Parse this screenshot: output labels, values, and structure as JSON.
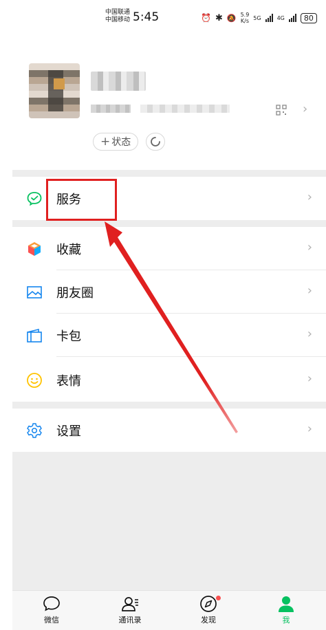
{
  "status_bar": {
    "carrier_1": "中国联通",
    "carrier_2": "中国移动",
    "time": "5:45",
    "net_speed_value": "5.9",
    "net_speed_unit": "K/s",
    "net_type_1": "5G",
    "net_type_2": "4G",
    "battery": "80"
  },
  "profile": {
    "status_button_plus": "+",
    "status_button_label": "状态"
  },
  "menu": {
    "items": [
      {
        "label": "服务",
        "icon": "service-icon"
      },
      {
        "label": "收藏",
        "icon": "favorites-icon"
      },
      {
        "label": "朋友圈",
        "icon": "moments-icon"
      },
      {
        "label": "卡包",
        "icon": "card-wallet-icon"
      },
      {
        "label": "表情",
        "icon": "stickers-icon"
      },
      {
        "label": "设置",
        "icon": "settings-icon"
      }
    ],
    "chevron": "›"
  },
  "tabbar": {
    "tabs": [
      {
        "label": "微信",
        "icon": "chat-icon"
      },
      {
        "label": "通讯录",
        "icon": "contacts-icon"
      },
      {
        "label": "发现",
        "icon": "compass-icon"
      },
      {
        "label": "我",
        "icon": "me-icon"
      }
    ],
    "active_color": "#07c160"
  },
  "colors": {
    "accent_green": "#07c160",
    "highlight_red": "#e02020",
    "separator_gray": "#ededed"
  }
}
